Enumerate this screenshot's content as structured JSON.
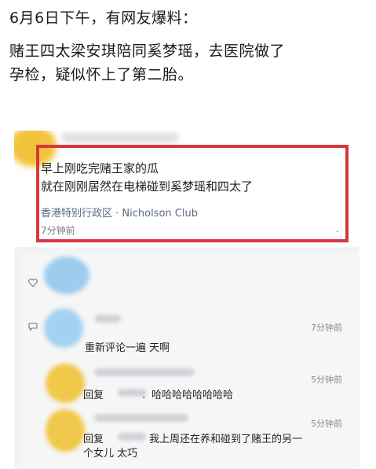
{
  "intro": {
    "line1": "6月6日下午，有网友爆料：",
    "line2": "赌王四太梁安琪陪同奚梦瑶，去医院做了",
    "line3": "孕检，疑似怀上了第二胎。"
  },
  "post": {
    "line1": "早上刚吃完赌王家的瓜",
    "line2": "就在刚刚居然在电梯碰到奚梦瑶和四太了",
    "location": "香港特别行政区 · Nicholson Club",
    "time": "7分钟前",
    "more": "·"
  },
  "comments": [
    {
      "time": "7分钟前",
      "text": "重新评论一遍 天啊"
    },
    {
      "time": "5分钟前",
      "reply_prefix": "回复",
      "text": "：哈哈哈哈哈哈哈哈"
    },
    {
      "time": "5分钟前",
      "reply_prefix": "回复",
      "text": "我上周还在养和碰到了赌王的另一",
      "text_cont": "个女儿 太巧"
    }
  ],
  "icons": {
    "like": "heart-outline-icon",
    "comment": "comment-bubble-icon"
  },
  "colors": {
    "highlight_border": "#d8373f",
    "location_text": "#5a6a84"
  }
}
